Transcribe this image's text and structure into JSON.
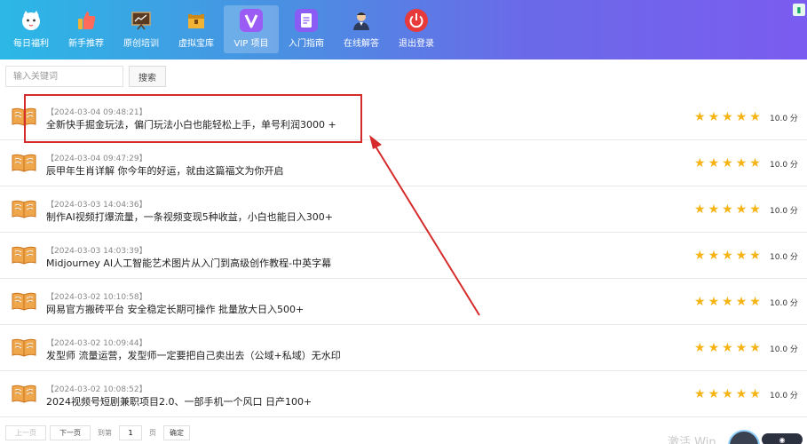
{
  "nav": {
    "items": [
      {
        "label": "每日福利",
        "icon": "cat-icon",
        "icon_color": "#ffffff",
        "icon_bg": "transparent"
      },
      {
        "label": "新手推荐",
        "icon": "thumbs-up-icon",
        "icon_color": "#ff5a5a",
        "icon_bg": "transparent"
      },
      {
        "label": "原创培训",
        "icon": "presentation-board-icon",
        "icon_color": "#6b4a2b",
        "icon_bg": "transparent"
      },
      {
        "label": "虚拟宝库",
        "icon": "treasure-box-icon",
        "icon_color": "#f2b233",
        "icon_bg": "transparent"
      },
      {
        "label": "VIP 项目",
        "icon": "vip-v-icon",
        "icon_color": "#ffffff",
        "icon_bg": "#9b5cf5"
      },
      {
        "label": "入门指南",
        "icon": "document-icon",
        "icon_color": "#ffffff",
        "icon_bg": "#8a5cf5"
      },
      {
        "label": "在线解答",
        "icon": "support-agent-icon",
        "icon_color": "#2d2d2d",
        "icon_bg": "transparent"
      },
      {
        "label": "退出登录",
        "icon": "power-icon",
        "icon_color": "#ffffff",
        "icon_bg": "#e83a3a"
      }
    ],
    "active_index": 4
  },
  "search": {
    "placeholder": "输入关键词",
    "button_label": "搜索"
  },
  "list": {
    "items": [
      {
        "date": "【2024-03-04 09:48:21】",
        "title": "全新快手掘金玩法，偏门玩法小白也能轻松上手，单号利润3000 +",
        "rating": 5,
        "score": "10.0 分"
      },
      {
        "date": "【2024-03-04 09:47:29】",
        "title": "辰甲年生肖详解 你今年的好运，就由这篇福文为你开启",
        "rating": 5,
        "score": "10.0 分"
      },
      {
        "date": "【2024-03-03 14:04:36】",
        "title": "制作AI视频打爆流量，一条视频变现5种收益，小白也能日入300+",
        "rating": 5,
        "score": "10.0 分"
      },
      {
        "date": "【2024-03-03 14:03:39】",
        "title": "Midjourney AI人工智能艺术图片从入门到高级创作教程-中英字幕",
        "rating": 5,
        "score": "10.0 分"
      },
      {
        "date": "【2024-03-02 10:10:58】",
        "title": "网易官方搬砖平台 安全稳定长期可操作 批量放大日入500+",
        "rating": 5,
        "score": "10.0 分"
      },
      {
        "date": "【2024-03-02 10:09:44】",
        "title": "发型师 流量运营，发型师一定要把自己卖出去（公域+私域）无水印",
        "rating": 5,
        "score": "10.0 分"
      },
      {
        "date": "【2024-03-02 10:08:52】",
        "title": "2024视频号短剧兼职项目2.0、一部手机一个风口 日产100+",
        "rating": 5,
        "score": "10.0 分"
      }
    ]
  },
  "pager": {
    "prev_label": "上一页",
    "next_label": "下一页",
    "goto_label": "到第",
    "page_value": "1",
    "page_unit": "页",
    "confirm_label": "确定"
  },
  "watermark": "激活 Win",
  "colors": {
    "star": "#f5b414",
    "annotation": "#d62b2b"
  }
}
